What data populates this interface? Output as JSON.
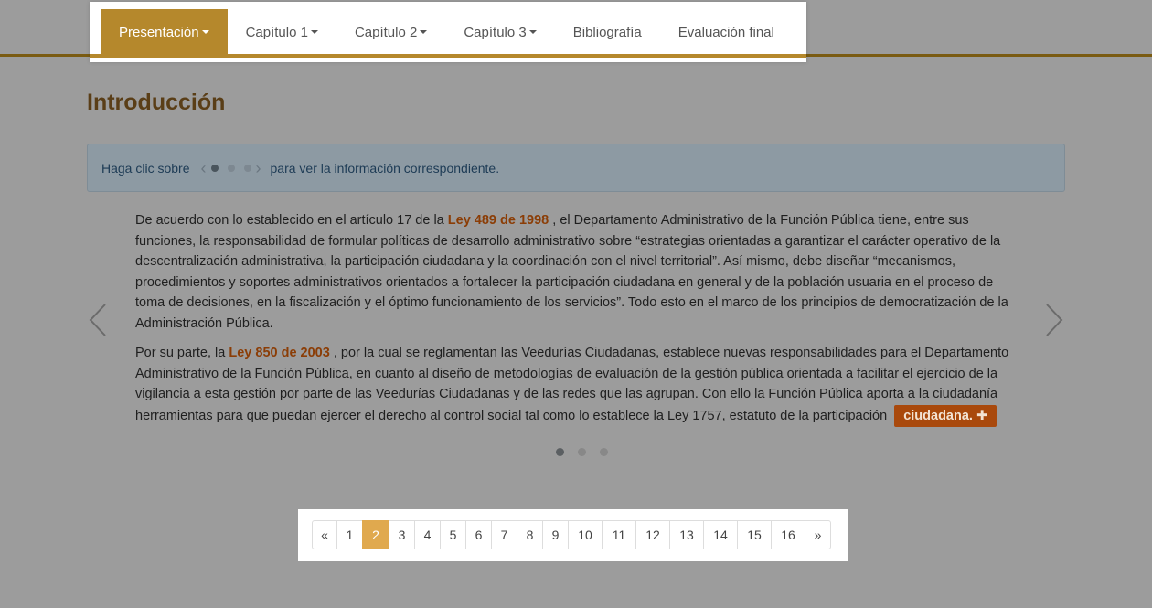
{
  "nav": {
    "items": [
      {
        "label": "Presentación",
        "caret": true,
        "active": true
      },
      {
        "label": "Capítulo 1",
        "caret": true
      },
      {
        "label": "Capítulo 2",
        "caret": true
      },
      {
        "label": "Capítulo 3",
        "caret": true
      },
      {
        "label": "Bibliografía",
        "caret": false
      },
      {
        "label": "Evaluación final",
        "caret": false
      }
    ]
  },
  "page": {
    "title": "Introducción"
  },
  "info": {
    "before": "Haga clic sobre",
    "after": "para ver la información correspondiente."
  },
  "slide": {
    "p1": {
      "t1": "De acuerdo con lo establecido en el artículo 17 de la ",
      "link": "Ley 489 de 1998",
      "t2": " , el Departamento Administrativo de la Función Pública tiene, entre sus funciones, la responsabilidad de formular políticas de desarrollo administrativo sobre “estrategias orientadas a garantizar el carácter operativo de la descentralización administrativa, la participación ciudadana y la coordinación con el nivel territorial”. Así mismo, debe diseñar “mecanismos, procedimientos y soportes administrativos orientados a fortalecer la participación ciudadana en general y de la población usuaria en el proceso de toma de decisiones, en la fiscalización y el óptimo funcionamiento de los servicios”. Todo esto en el marco de los principios de democratización de la Administración Pública."
    },
    "p2": {
      "t1": "Por su parte, la ",
      "link": "Ley 850 de 2003",
      "t2": " , por la cual se reglamentan las Veedurías Ciudadanas, establece nuevas responsabilidades para el Departamento Administrativo de la Función Pública, en cuanto al diseño de metodologías de evaluación de la gestión pública orientada a facilitar el ejercicio de la vigilancia a esta gestión por parte de las Veedurías Ciudadanas y de las redes que las agrupan. Con ello la Función Pública aporta a la ciudadanía herramientas para que puedan ejercer el derecho al control social tal como lo establece la Ley 1757, estatuto de la participación",
      "button": "ciudadana. ✚"
    }
  },
  "carousel": {
    "slides": 3,
    "active_index": 0
  },
  "pagination": {
    "prev": "«",
    "next": "»",
    "pages": [
      "1",
      "2",
      "3",
      "4",
      "5",
      "6",
      "7",
      "8",
      "9",
      "10",
      "11",
      "12",
      "13",
      "14",
      "15",
      "16"
    ],
    "active": "2"
  },
  "colors": {
    "accent": "#b5882c",
    "link": "#8b3d06",
    "button": "#a9490c",
    "page_active": "#e0a94e"
  }
}
